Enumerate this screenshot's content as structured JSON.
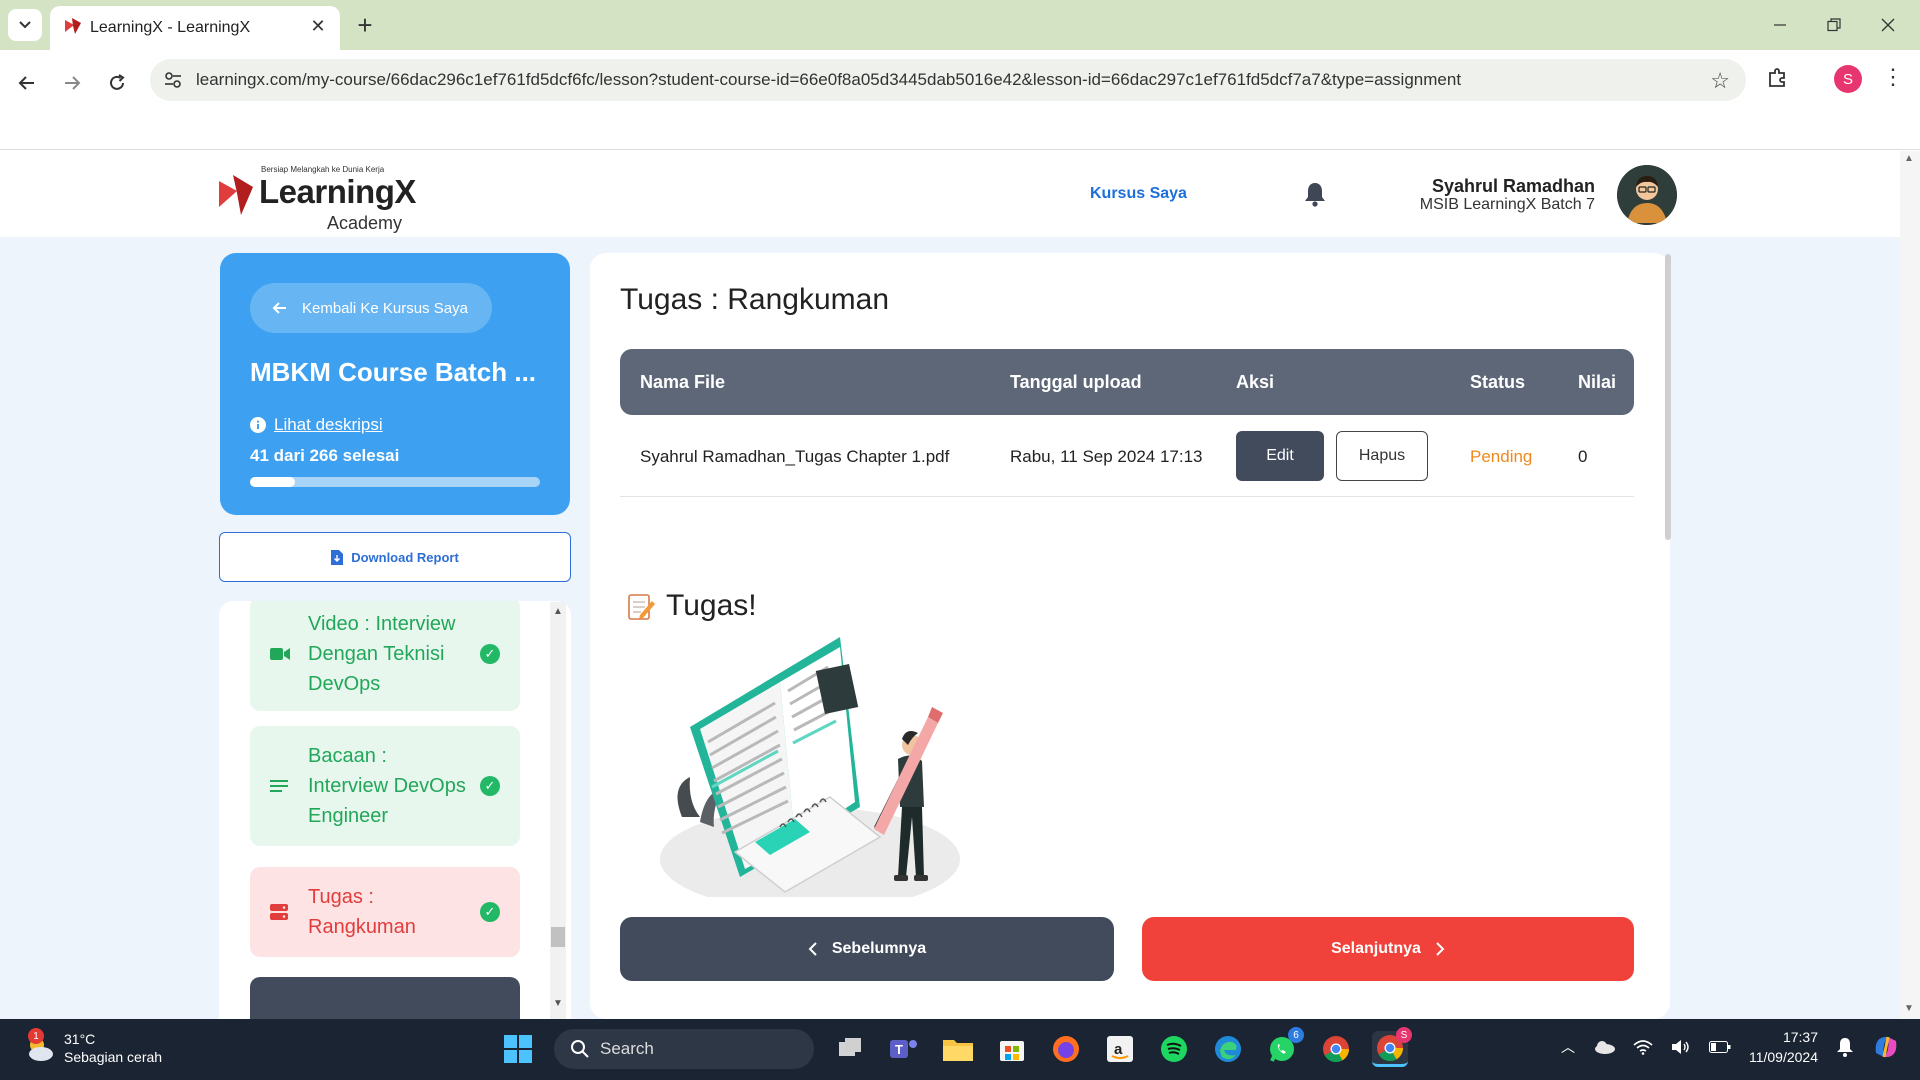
{
  "browser": {
    "tab_title": "LearningX - LearningX",
    "url": "learningx.com/my-course/66dac296c1ef761fd5dcf6fc/lesson?student-course-id=66e0f8a05d3445dab5016e42&lesson-id=66dac297c1ef761fd5dcf7a7&type=assignment",
    "profile_initial": "S"
  },
  "header": {
    "logo_tagline": "Bersiap Melangkah ke Dunia Kerja",
    "logo_main": "LearningX",
    "logo_sub": "Academy",
    "nav_link": "Kursus Saya",
    "user_name": "Syahrul Ramadhan",
    "user_role": "MSIB LearningX Batch 7"
  },
  "sidebar": {
    "back_label": "Kembali Ke Kursus Saya",
    "course_title": "MBKM Course Batch ...",
    "description_link": "Lihat deskripsi",
    "progress_text": "41 dari 266 selesai",
    "progress_done": 41,
    "progress_total": 266,
    "download_label": "Download Report",
    "lessons": [
      {
        "label": "Video : Interview Dengan Teknisi DevOps",
        "icon": "video-icon",
        "status": "done"
      },
      {
        "label": "Bacaan : Interview DevOps Engineer",
        "icon": "list-icon",
        "status": "done"
      },
      {
        "label": "Tugas : Rangkuman",
        "icon": "task-icon",
        "status": "done"
      }
    ]
  },
  "main": {
    "title": "Tugas : Rangkuman",
    "table": {
      "headers": [
        "Nama File",
        "Tanggal upload",
        "Aksi",
        "Status",
        "Nilai"
      ],
      "row": {
        "file": "Syahrul Ramadhan_Tugas Chapter 1.pdf",
        "date": "Rabu, 11 Sep 2024 17:13",
        "edit_label": "Edit",
        "delete_label": "Hapus",
        "status": "Pending",
        "score": "0"
      }
    },
    "section_heading": "Tugas!",
    "prev_label": "Sebelumnya",
    "next_label": "Selanjutnya"
  },
  "taskbar": {
    "weather_temp": "31°C",
    "weather_desc": "Sebagian cerah",
    "weather_badge": "1",
    "search_label": "Search",
    "whatsapp_badge": "6",
    "time": "17:37",
    "date": "11/09/2024"
  },
  "colors": {
    "primary_blue": "#3ea0f0",
    "danger_red": "#f0423a",
    "dark_slate": "#414b5c",
    "pending_orange": "#f0891c",
    "success_green": "#22a75a"
  }
}
